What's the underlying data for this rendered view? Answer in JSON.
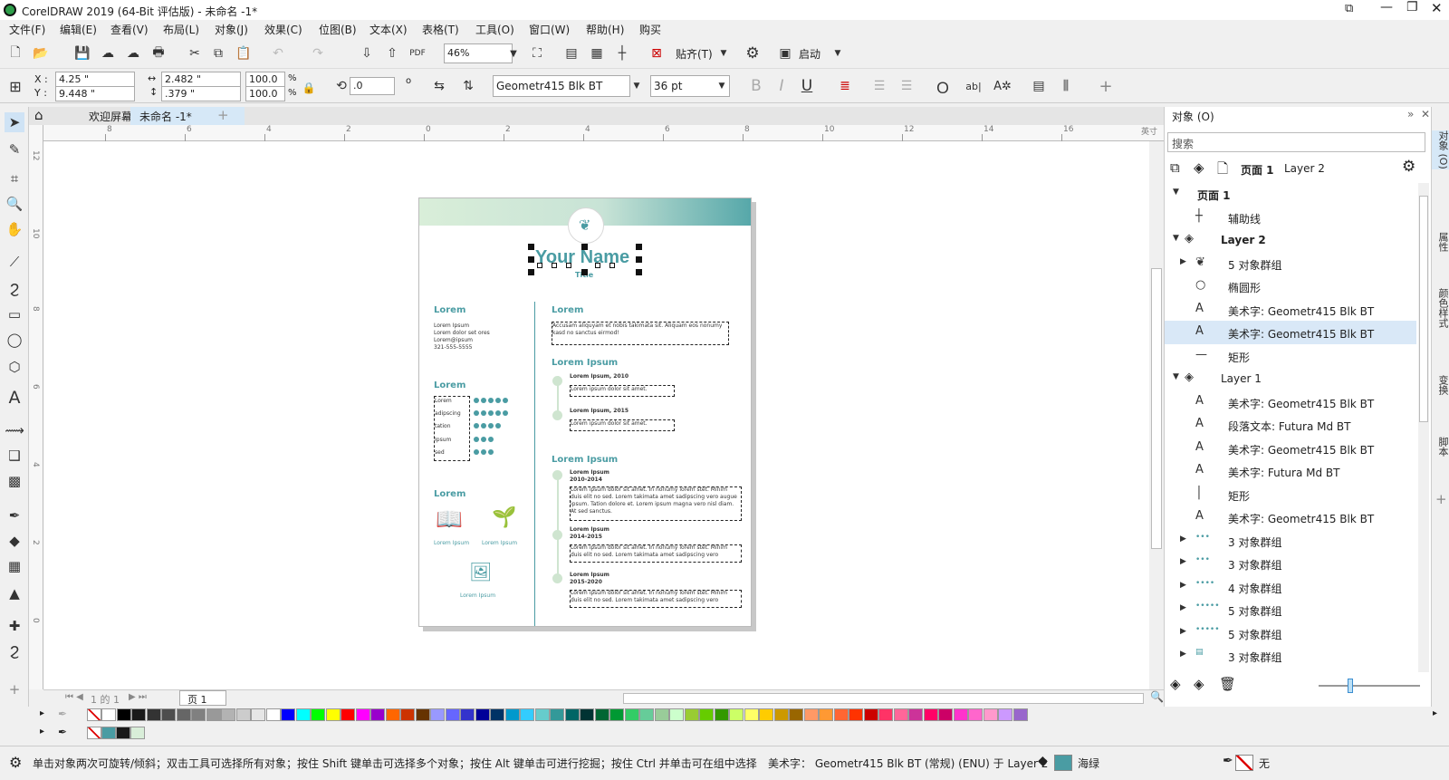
{
  "app": {
    "title": "CorelDRAW 2019 (64-Bit 评估版) - 未命名 -1*"
  },
  "menu": [
    "文件(F)",
    "编辑(E)",
    "查看(V)",
    "布局(L)",
    "对象(J)",
    "效果(C)",
    "位图(B)",
    "文本(X)",
    "表格(T)",
    "工具(O)",
    "窗口(W)",
    "帮助(H)",
    "购买"
  ],
  "stdbar": {
    "zoom": "46%",
    "snap": "贴齐(T)",
    "launch": "启动"
  },
  "propbar": {
    "x_label": "X :",
    "y_label": "Y :",
    "x": "4.25 \"",
    "y": "9.448 \"",
    "w": "2.482 \"",
    "h": ".379 \"",
    "sx": "100.0",
    "sy": "100.0",
    "pct": "%",
    "angle": ".0",
    "deg": "o",
    "font": "Geometr415 Blk BT",
    "size": "36 pt",
    "bold": "B",
    "italic": "I",
    "underline": "U"
  },
  "tabs": {
    "welcome": "欢迎屏幕",
    "doc": "未命名 -1*",
    "add": "+"
  },
  "ruler": {
    "h_ticks": [
      "8",
      "6",
      "4",
      "2",
      "0",
      "2",
      "4",
      "6",
      "8",
      "10",
      "12",
      "14",
      "16"
    ],
    "h_unit": "英寸",
    "v_ticks": [
      "12",
      "10",
      "8",
      "6",
      "4",
      "2",
      "0"
    ]
  },
  "resume": {
    "name": "Your Name",
    "title": "Title",
    "left_h1": "Lorem",
    "contact": [
      "Lorem Ipsum",
      "Lorem dolor set ores",
      "Lorem@ipsum",
      "321-555-5555"
    ],
    "left_h2": "Lorem",
    "skills": [
      "Lorem",
      "adipscing",
      "tation",
      "Ipsum",
      "sed"
    ],
    "skill_levels": [
      5,
      5,
      4,
      3,
      3
    ],
    "left_h3": "Lorem",
    "icon_labels": [
      "Lorem Ipsum",
      "Lorem Ipsum",
      "Lorem Ipsum"
    ],
    "right_h1": "Lorem",
    "summary": "Accusam aliquyam et nobis takimata sit. Aliquam eos nonumy kasd no sanctus eirmod!",
    "right_h2": "Lorem Ipsum",
    "edu": [
      {
        "head": "Lorem Ipsum, 2010",
        "text": "Lorem ipsum dolor sit amet."
      },
      {
        "head": "Lorem Ipsum, 2015",
        "text": "Lorem ipsum dolor sit amet."
      }
    ],
    "right_h3": "Lorem Ipsum",
    "work": [
      {
        "head": "Lorem Ipsum",
        "years": "2010-2014",
        "text": "Lorem ipsum dolor sit amet. In nonumy lorem stet. Minim duis elit no sed. Lorem takimata amet sadipscing vero augue ipsum. Tation dolore et. Lorem ipsum magna vero nisl diam. At sed sanctus."
      },
      {
        "head": "Lorem Ipsum",
        "years": "2014-2015",
        "text": "Lorem ipsum dolor sit amet. In nonumy lorem stet. Minim duis elit no sed. Lorem takimata amet sadipscing vero"
      },
      {
        "head": "Lorem Ipsum",
        "years": "2015-2020",
        "text": "Lorem ipsum dolor sit amet. In nonumy lorem stet. Minim duis elit no sed. Lorem takimata amet sadipscing vero"
      }
    ]
  },
  "pagebar": {
    "nav": "1 的 1",
    "page": "页 1"
  },
  "objects": {
    "title": "对象 (O)",
    "search": "搜索",
    "page_label": "页面 1",
    "layer_label": "Layer 2",
    "tree": [
      {
        "label": "页面 1",
        "bold": true
      },
      {
        "label": "辅助线"
      },
      {
        "label": "Layer 2",
        "bold": true
      },
      {
        "label": "5 对象群组"
      },
      {
        "label": "椭圆形"
      },
      {
        "label": "美术字: Geometr415 Blk BT"
      },
      {
        "label": "美术字: Geometr415 Blk BT",
        "selected": true
      },
      {
        "label": "矩形"
      },
      {
        "label": "Layer 1"
      },
      {
        "label": "美术字: Geometr415 Blk BT"
      },
      {
        "label": "段落文本: Futura Md BT"
      },
      {
        "label": "美术字: Geometr415 Blk BT"
      },
      {
        "label": "美术字: Futura Md BT"
      },
      {
        "label": "矩形"
      },
      {
        "label": "美术字: Geometr415 Blk BT"
      },
      {
        "label": "3 对象群组"
      },
      {
        "label": "3 对象群组"
      },
      {
        "label": "4 对象群组"
      },
      {
        "label": "5 对象群组"
      },
      {
        "label": "5 对象群组"
      },
      {
        "label": "3 对象群组"
      }
    ]
  },
  "sidetabs": [
    "对象 (O)",
    "属性",
    "颜色样式",
    "变换",
    "脚本"
  ],
  "status": {
    "hint": "单击对象两次可旋转/倾斜；双击工具可选择所有对象；按住 Shift 键单击可选择多个对象；按住 Alt 键单击可进行挖掘；按住 Ctrl 并单击可在组中选择",
    "info": "美术字： Geometr415 Blk BT (常规) (ENU) 于 Layer 2",
    "fill": "海绿",
    "outline": "无"
  },
  "colors": {
    "teal": "#4a9ca3",
    "palette": [
      "#ffffff",
      "#000000",
      "#1a1a1a",
      "#333333",
      "#4d4d4d",
      "#666666",
      "#808080",
      "#999999",
      "#b3b3b3",
      "#cccccc",
      "#e6e6e6",
      "#ffffff",
      "#0000ff",
      "#00ffff",
      "#00ff00",
      "#ffff00",
      "#ff0000",
      "#ff00ff",
      "#9900cc",
      "#ff6600",
      "#cc3300",
      "#663300",
      "#9999ff",
      "#6666ff",
      "#3333cc",
      "#000099",
      "#003366",
      "#0099cc",
      "#33ccff",
      "#66cccc",
      "#339999",
      "#006666",
      "#003333",
      "#006633",
      "#009933",
      "#33cc66",
      "#66cc99",
      "#99cc99",
      "#ccffcc",
      "#99cc33",
      "#66cc00",
      "#339900",
      "#ccff66",
      "#ffff66",
      "#ffcc00",
      "#cc9900",
      "#996600",
      "#ff9966",
      "#ff9933",
      "#ff6633",
      "#ff3300",
      "#cc0000",
      "#ff3366",
      "#ff6699",
      "#cc3399",
      "#ff0066",
      "#cc0066",
      "#ff33cc",
      "#ff66cc",
      "#ff99cc",
      "#cc99ff",
      "#9966cc"
    ]
  }
}
